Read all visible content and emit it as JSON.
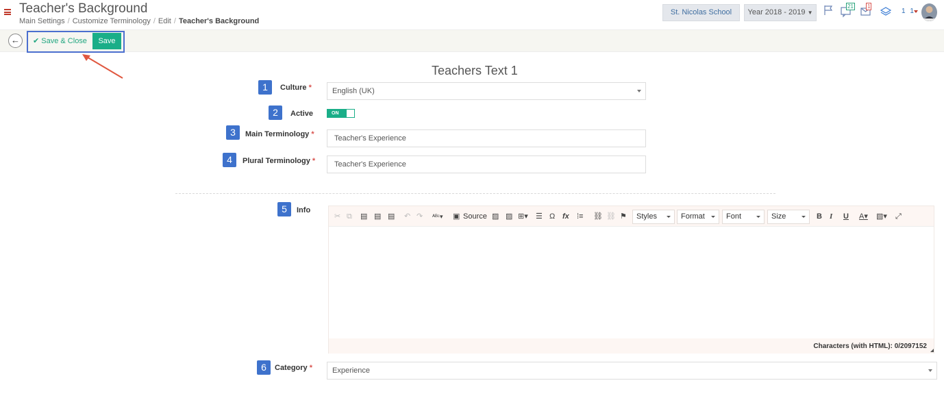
{
  "header": {
    "title": "Teacher's Background",
    "breadcrumb": [
      "Main Settings",
      "Customize Terminology",
      "Edit",
      "Teacher's Background"
    ],
    "school": "St. Nicolas School",
    "year": "Year 2018 - 2019",
    "notifications_count": "21",
    "messages_count": "1",
    "user_label": "1 1"
  },
  "toolbar": {
    "save_close_label": "Save & Close",
    "save_label": "Save"
  },
  "form": {
    "title": "Teachers Text 1",
    "culture": {
      "num": "1",
      "label": "Culture",
      "value": "English (UK)"
    },
    "active": {
      "num": "2",
      "label": "Active",
      "toggle_text": "ON"
    },
    "main_term": {
      "num": "3",
      "label": "Main Terminology",
      "value": "Teacher's Experience"
    },
    "plural_term": {
      "num": "4",
      "label": "Plural Terminology",
      "value": "Teacher's Experience"
    },
    "info": {
      "num": "5",
      "label": "Info"
    },
    "category": {
      "num": "6",
      "label": "Category",
      "value": "Experience"
    }
  },
  "editor": {
    "source_label": "Source",
    "styles_label": "Styles",
    "format_label": "Format",
    "font_label": "Font",
    "size_label": "Size",
    "char_count": "Characters (with HTML): 0/2097152"
  },
  "colors": {
    "accent_green": "#1aae88",
    "badge_blue": "#3e72cc",
    "highlight_blue": "#4b6fcf",
    "arrow_red": "#e0573f"
  }
}
